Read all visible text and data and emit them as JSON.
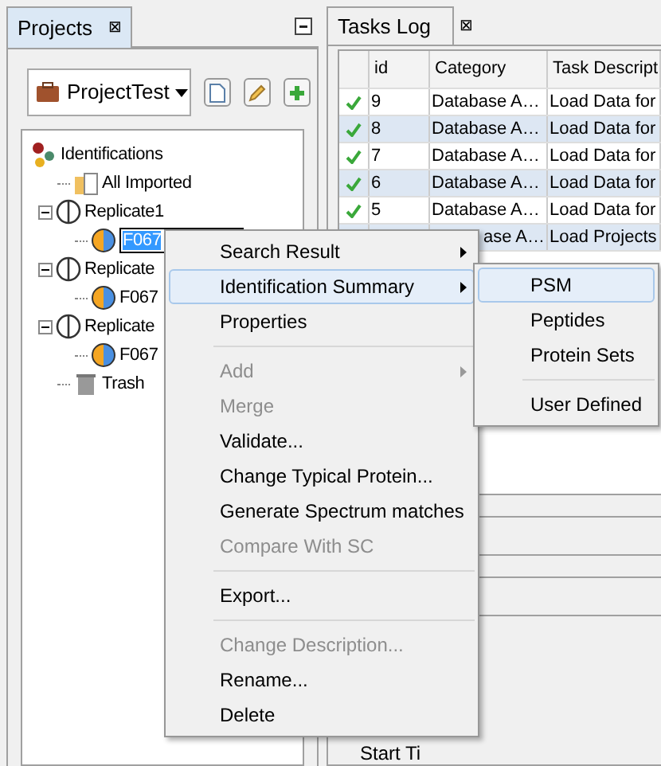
{
  "projects_panel": {
    "title": "Projects",
    "close": "⊠",
    "project_selector": {
      "value": "ProjectTest"
    },
    "tree": [
      {
        "label": "Identifications",
        "kind": "root",
        "children": [
          {
            "label": "All Imported",
            "kind": "folder"
          },
          {
            "label": "Replicate1",
            "kind": "replicate",
            "expanded": true,
            "children": [
              {
                "label": "F067",
                "kind": "editing"
              }
            ]
          },
          {
            "label": "Replicate",
            "kind": "replicate",
            "expanded": true,
            "children": [
              {
                "label": "F067",
                "kind": "dataset"
              }
            ]
          },
          {
            "label": "Replicate",
            "kind": "replicate",
            "expanded": true,
            "children": [
              {
                "label": "F067",
                "kind": "dataset"
              }
            ]
          },
          {
            "label": "Trash",
            "kind": "trash"
          }
        ]
      }
    ]
  },
  "tasks_panel": {
    "title": "Tasks Log",
    "close": "⊠",
    "columns": [
      "id",
      "Category",
      "Task Descript"
    ],
    "rows": [
      {
        "id": "9",
        "category": "Database A…",
        "description": "Load Data for",
        "done": true,
        "selected": false
      },
      {
        "id": "8",
        "category": "Database A…",
        "description": "Load Data for",
        "done": true,
        "selected": true
      },
      {
        "id": "7",
        "category": "Database A…",
        "description": "Load Data for",
        "done": true,
        "selected": false
      },
      {
        "id": "6",
        "category": "Database A…",
        "description": "Load Data for",
        "done": true,
        "selected": true
      },
      {
        "id": "5",
        "category": "Database A…",
        "description": "Load Data for",
        "done": true,
        "selected": false
      },
      {
        "category": "ase A…",
        "description": "Load Projects",
        "selected": true
      }
    ],
    "details_label": "Start Ti"
  },
  "context_menu": [
    {
      "label": "Search Result",
      "submenu": true,
      "disabled": false,
      "selected": false
    },
    {
      "label": "Identification Summary",
      "submenu": true,
      "disabled": false,
      "selected": true
    },
    {
      "label": "Properties",
      "disabled": false,
      "selected": false
    },
    {
      "kind": "separator"
    },
    {
      "label": "Add",
      "submenu": true,
      "disabled": true,
      "selected": false
    },
    {
      "label": "Merge",
      "disabled": true,
      "selected": false
    },
    {
      "label": "Validate...",
      "disabled": false,
      "selected": false
    },
    {
      "label": "Change Typical Protein...",
      "disabled": false,
      "selected": false
    },
    {
      "label": "Generate Spectrum matches",
      "disabled": false,
      "selected": false
    },
    {
      "label": "Compare With SC",
      "disabled": true,
      "selected": false
    },
    {
      "kind": "separator"
    },
    {
      "label": "Export...",
      "disabled": false,
      "selected": false
    },
    {
      "kind": "separator"
    },
    {
      "label": "Change Description...",
      "disabled": true,
      "selected": false
    },
    {
      "label": "Rename...",
      "disabled": false,
      "selected": false
    },
    {
      "label": "Delete",
      "disabled": false,
      "selected": false
    }
  ],
  "submenu": [
    {
      "label": "PSM",
      "selected": true
    },
    {
      "label": "Peptides",
      "selected": false
    },
    {
      "label": "Protein Sets",
      "selected": false
    },
    {
      "kind": "separator"
    },
    {
      "label": "User Defined",
      "selected": false
    }
  ]
}
